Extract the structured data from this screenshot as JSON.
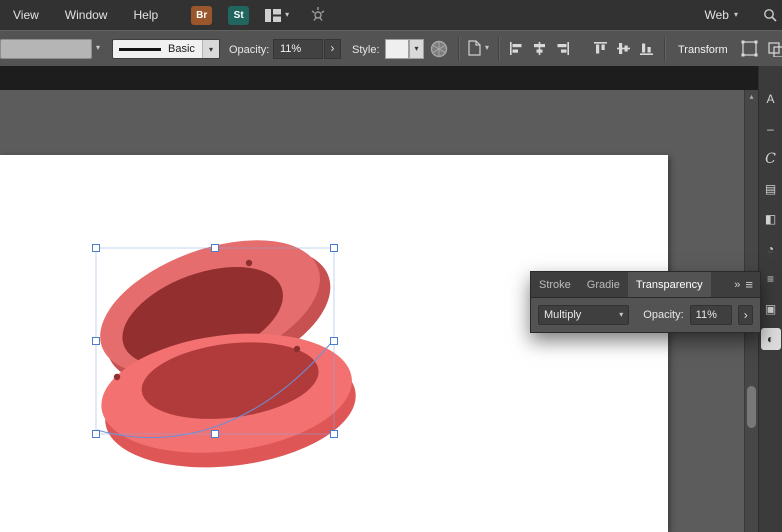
{
  "menubar": {
    "menus": [
      "View",
      "Window",
      "Help"
    ],
    "bridge_badge": "Br",
    "stock_badge": "St",
    "workspace": "Web"
  },
  "control_bar": {
    "stroke_preset": "Basic",
    "opacity_label": "Opacity:",
    "opacity_value": "11%",
    "style_label": "Style:",
    "transform_label": "Transform"
  },
  "transparency_panel": {
    "tabs": [
      "Stroke",
      "Gradie",
      "Transparency"
    ],
    "active_tab": "Transparency",
    "blend_mode": "Multiply",
    "opacity_label": "Opacity:",
    "opacity_value": "11%"
  },
  "dock": {
    "items": [
      {
        "name": "artboards",
        "glyph": "A",
        "active": false
      },
      {
        "name": "appearance",
        "glyph": "–",
        "active": false
      },
      {
        "name": "color",
        "glyph": "C",
        "active": false
      },
      {
        "name": "swatches",
        "glyph": "▤",
        "active": false
      },
      {
        "name": "gradient",
        "glyph": "◧",
        "active": false
      },
      {
        "name": "stroke",
        "glyph": "◔",
        "active": false
      },
      {
        "name": "layers",
        "glyph": "≡",
        "active": false
      },
      {
        "name": "libraries",
        "glyph": "▣",
        "active": false
      },
      {
        "name": "transparency",
        "glyph": "◐",
        "active": true
      }
    ]
  },
  "icons": {
    "chevron_down": "▾",
    "stepper": "›",
    "menu": "≡",
    "overflow": "»",
    "scroll_up": "▴"
  },
  "colors": {
    "selection_blue": "#4a7dd0",
    "path_blue": "#6b8fd8",
    "coral": "#f47171",
    "lid_red": "#e66d6d",
    "inner_maroon": "#93302f",
    "inner_dark_red": "#b13b3b",
    "artboard": "#ffffff",
    "ui_dark": "#323232",
    "ui_mid": "#535353"
  }
}
